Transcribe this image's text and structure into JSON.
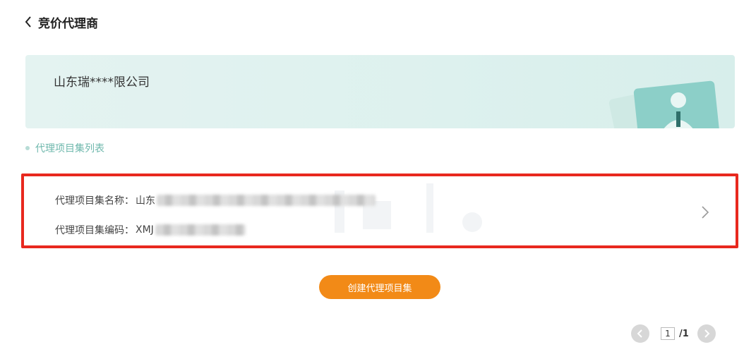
{
  "header": {
    "title": "竞价代理商"
  },
  "company": {
    "name": "山东瑞****限公司"
  },
  "section": {
    "title": "代理项目集列表"
  },
  "project_list": [
    {
      "name_label": "代理项目集名称：",
      "name_value": "山东",
      "code_label": "代理项目集编码：",
      "code_value": "XMJ"
    }
  ],
  "actions": {
    "create_label": "创建代理项目集"
  },
  "pagination": {
    "current": "1",
    "total": "/1"
  },
  "icons": [
    "chevron-left-icon",
    "chevron-right-icon",
    "prev-page-icon",
    "next-page-icon",
    "id-card-illustration"
  ],
  "colors": {
    "accent": "#f28a17",
    "highlight_border": "#e8281e",
    "card_bg": "#e4f3f1",
    "section_text": "#6fb8ad"
  }
}
